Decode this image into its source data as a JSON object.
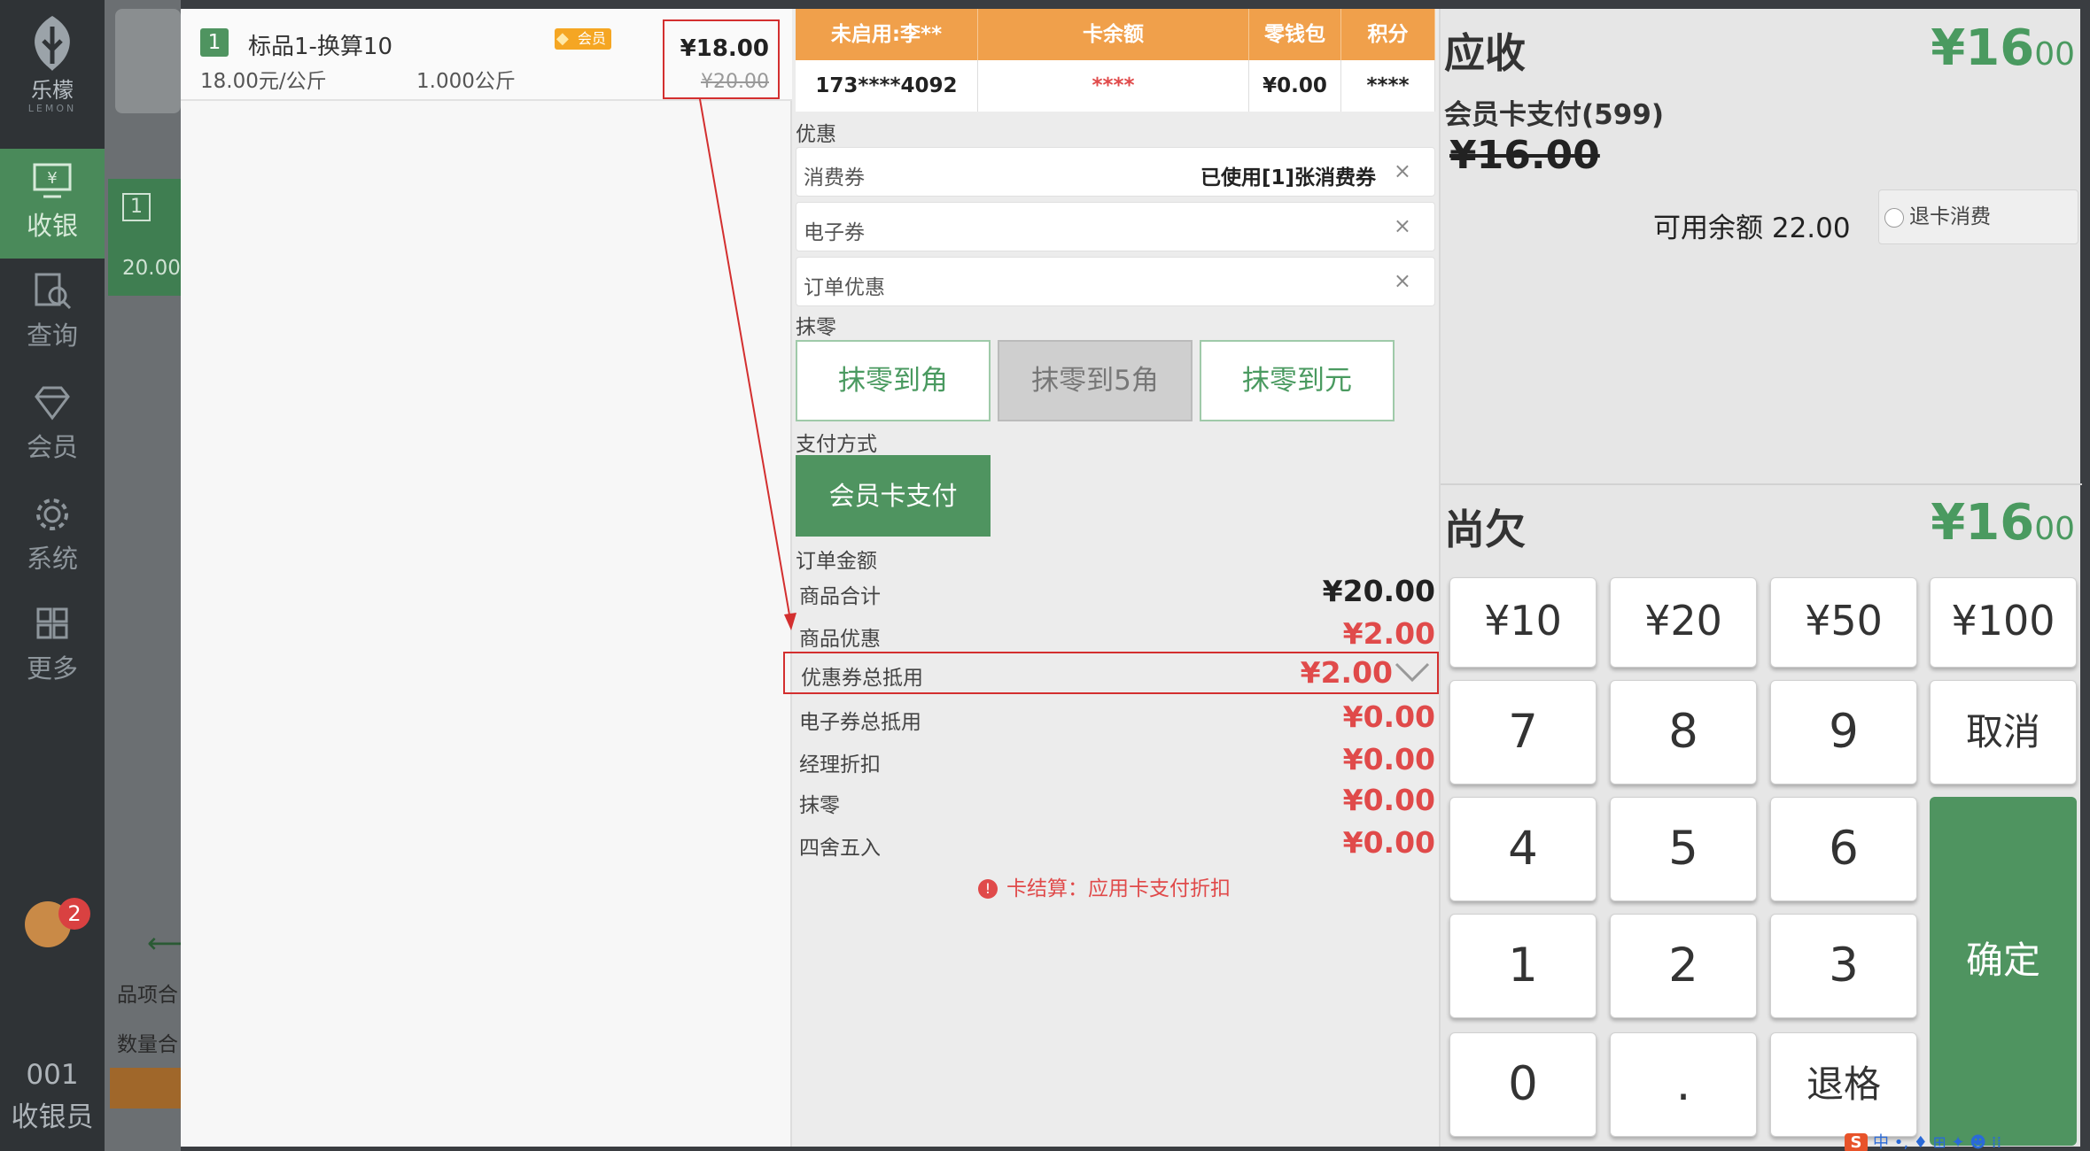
{
  "nav": {
    "logo_text": "乐檬",
    "logo_sub": "LEMON",
    "items": [
      {
        "label": "收银",
        "icon": "cashier-icon"
      },
      {
        "label": "查询",
        "icon": "search-icon"
      },
      {
        "label": "会员",
        "icon": "member-icon"
      },
      {
        "label": "系统",
        "icon": "gear-icon"
      },
      {
        "label": "更多",
        "icon": "grid-icon"
      }
    ],
    "notif_count": "2",
    "employee_no": "001",
    "employee_title": "收银员"
  },
  "background": {
    "item_index": "1",
    "item_price": "20.00",
    "summary1": "品项合",
    "summary2": "数量合"
  },
  "cart": {
    "items": [
      {
        "index": "1",
        "name": "标品1-换算10",
        "badge": "会员",
        "unit_price": "18.00元/公斤",
        "qty": "1.000公斤",
        "price": "¥18.00",
        "original_price": "¥20.00"
      }
    ]
  },
  "member_table": {
    "headers": [
      "未启用:李**",
      "卡余额",
      "零钱包",
      "积分"
    ],
    "row": [
      "173****4092",
      "****",
      "¥0.00",
      "****"
    ]
  },
  "discount": {
    "section_label": "优惠",
    "rows": [
      {
        "label": "消费券",
        "value": "已使用[1]张消费券",
        "clear": "×"
      },
      {
        "label": "电子券",
        "value": "",
        "clear": "×"
      },
      {
        "label": "订单优惠",
        "value": "",
        "clear": "×"
      }
    ]
  },
  "rounding": {
    "section_label": "抹零",
    "buttons": [
      "抹零到角",
      "抹零到5角",
      "抹零到元"
    ]
  },
  "payment": {
    "section_label": "支付方式",
    "method": "会员卡支付"
  },
  "order_amount": {
    "section_label": "订单金额",
    "rows": [
      {
        "label": "商品合计",
        "value": "¥20.00"
      },
      {
        "label": "商品优惠",
        "value": "¥2.00"
      },
      {
        "label": "优惠券总抵用",
        "value": "¥2.00"
      },
      {
        "label": "电子券总抵用",
        "value": "¥0.00"
      },
      {
        "label": "经理折扣",
        "value": "¥0.00"
      },
      {
        "label": "抹零",
        "value": "¥0.00"
      },
      {
        "label": "四舍五入",
        "value": "¥0.00"
      }
    ],
    "note": "卡结算：应用卡支付折扣"
  },
  "receivable": {
    "title": "应收",
    "amount_main": "¥16",
    "amount_dec": "00",
    "pay_line": "会员卡支付(599)",
    "pay_amount": "¥16.00",
    "balance": "可用余额 22.00",
    "refund_label": "退卡消费"
  },
  "owed": {
    "title": "尚欠",
    "amount_main": "¥16",
    "amount_dec": "00"
  },
  "keypad": {
    "quick": [
      "¥10",
      "¥20",
      "¥50",
      "¥100"
    ],
    "rows": [
      [
        "7",
        "8",
        "9"
      ],
      [
        "4",
        "5",
        "6"
      ],
      [
        "1",
        "2",
        "3"
      ],
      [
        "0",
        ".",
        "退格"
      ]
    ],
    "cancel": "取消",
    "confirm": "确定"
  },
  "ime": {
    "logo": "S",
    "text": "中 •, ♦ ⊞ ✦ ☻ ⁞⁞"
  },
  "colors": {
    "green": "#4f9460",
    "orange": "#f0a04b",
    "red": "#e04a4a",
    "highlight": "#d32f2f"
  }
}
